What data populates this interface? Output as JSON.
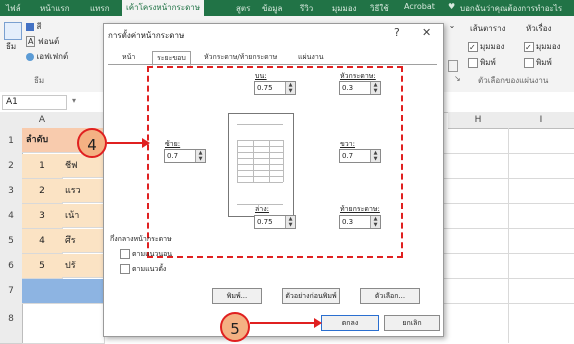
{
  "ribbon_tabs": [
    "ไฟล์",
    "หน้าแรก",
    "แทรก",
    "เค้าโครงหน้ากระดาษ",
    "สูตร",
    "ข้อมูล",
    "รีวิว",
    "มุมมอง",
    "วิธีใช้",
    "Acrobat",
    "บอกฉันว่าคุณต้องการทำอะไร"
  ],
  "ribbon": {
    "themes": "ธีม",
    "colors": "สี",
    "fonts": "ฟอนต์",
    "effects": "เอฟเฟกต์",
    "themes_group": "ธีม",
    "gridlines": "เส้นตาราง",
    "headings": "หัวเรื่อง",
    "view": "มุมมอง",
    "print": "พิมพ์",
    "sheet_options": "ตัวเลือกของแผ่นงาน"
  },
  "name_box": "A1",
  "columns": [
    "A",
    "H",
    "I"
  ],
  "rows": [
    "1",
    "2",
    "3",
    "4",
    "5",
    "6",
    "7",
    "8"
  ],
  "cells": {
    "header": "ลำดับ",
    "numbers": [
      "1",
      "2",
      "3",
      "4",
      "5"
    ],
    "col_b": [
      "ชีฟ",
      "แรว",
      "เน้า",
      "ศึร",
      "ปรั"
    ]
  },
  "dialog": {
    "title": "การตั้งค่าหน้ากระดาษ",
    "help": "?",
    "close": "✕",
    "tabs": [
      "หน้า",
      "ระยะขอบ",
      "หัวกระดาษ/ท้ายกระดาษ",
      "แผ่นงาน"
    ],
    "active_tab": 1,
    "margins": {
      "top_label": "บน:",
      "top_value": "0.75",
      "header_label": "หัวกระดาษ:",
      "header_value": "0.3",
      "left_label": "ซ้าย:",
      "left_value": "0.7",
      "right_label": "ขวา:",
      "right_value": "0.7",
      "bottom_label": "ล่าง:",
      "bottom_value": "0.75",
      "footer_label": "ท้ายกระดาษ:",
      "footer_value": "0.3"
    },
    "center_title": "กึ่งกลางหน้ากระดาษ",
    "center_horizontal": "ตามแนวนอน",
    "center_vertical": "ตามแนวตั้ง",
    "print_button": "พิมพ์...",
    "preview_button": "ตัวอย่างก่อนพิมพ์",
    "options_button": "ตัวเลือก...",
    "ok_button": "ตกลง",
    "cancel_button": "ยกเลิก"
  },
  "callouts": [
    "4",
    "5"
  ],
  "colors": {
    "excel_green": "#217346",
    "highlight": "#e02020",
    "callout_fill": "#f4b183",
    "cell_fill": "#fbe3c4",
    "row7_fill": "#8db4e2"
  }
}
